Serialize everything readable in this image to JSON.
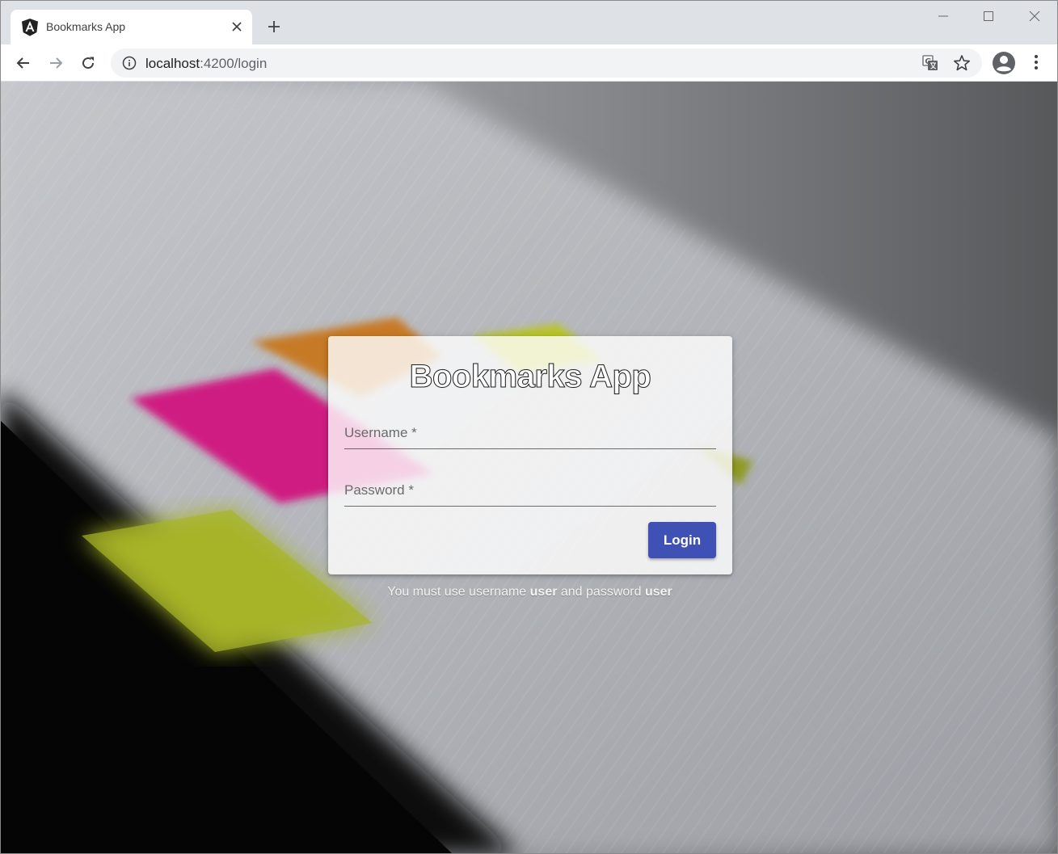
{
  "browser": {
    "tab_title": "Bookmarks App",
    "url_host": "localhost",
    "url_rest": ":4200/login",
    "icons": {
      "tab_favicon": "angular-logo-icon",
      "tab_close": "close-icon",
      "new_tab": "plus-icon",
      "back": "arrow-left-icon",
      "forward": "arrow-right-icon",
      "reload": "reload-icon",
      "site_info": "info-icon",
      "translate": "translate-icon",
      "bookmark": "star-icon",
      "profile": "account-circle-icon",
      "menu": "more-vert-icon"
    }
  },
  "login": {
    "title": "Bookmarks App",
    "username_label": "Username *",
    "username_value": "",
    "password_label": "Password *",
    "password_value": "",
    "button_label": "Login"
  },
  "hint": {
    "part1": "You must use username ",
    "username": "user",
    "part2": " and password ",
    "password": "user"
  },
  "colors": {
    "primary": "#3f51b5",
    "chrome_tabstrip": "#dee1e6",
    "omnibox": "#f1f3f4"
  }
}
